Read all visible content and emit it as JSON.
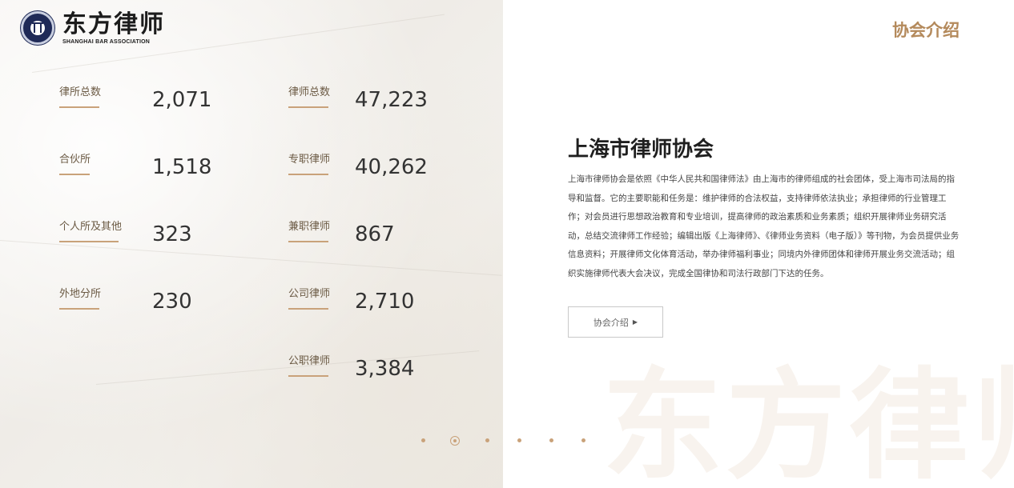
{
  "logo": {
    "name_cn": "东方律师",
    "name_en": "SHANGHAI BAR ASSOCIATION"
  },
  "header": {
    "nav_label": "协会介绍"
  },
  "stats_left": [
    {
      "label": "律所总数",
      "value": "2,071"
    },
    {
      "label": "合伙所",
      "value": "1,518"
    },
    {
      "label": "个人所及其他",
      "value": "323"
    },
    {
      "label": "外地分所",
      "value": "230"
    }
  ],
  "stats_right": [
    {
      "label": "律师总数",
      "value": "47,223"
    },
    {
      "label": "专职律师",
      "value": "40,262"
    },
    {
      "label": "兼职律师",
      "value": "867"
    },
    {
      "label": "公司律师",
      "value": "2,710"
    },
    {
      "label": "公职律师",
      "value": "3,384"
    }
  ],
  "association": {
    "title": "上海市律师协会",
    "description": "上海市律师协会是依照《中华人民共和国律师法》由上海市的律师组成的社会团体，受上海市司法局的指导和监督。它的主要职能和任务是：维护律师的合法权益，支持律师依法执业；承担律师的行业管理工作；对会员进行思想政治教育和专业培训，提高律师的政治素质和业务素质；组织开展律师业务研究活动，总结交流律师工作经验；编辑出版《上海律师》、《律师业务资料（电子版）》等刊物，为会员提供业务信息资料；开展律师文化体育活动，举办律师福利事业；同境内外律师团体和律师开展业务交流活动；组织实施律师代表大会决议，完成全国律协和司法行政部门下达的任务。",
    "button_label": "协会介绍",
    "button_arrow": "▶"
  },
  "watermark": "东方律师",
  "pagination": {
    "count": 6,
    "active_index": 1
  },
  "colors": {
    "accent": "#c9a27a",
    "header_link": "#b48a5c",
    "logo_seal": "#1f2a57"
  }
}
